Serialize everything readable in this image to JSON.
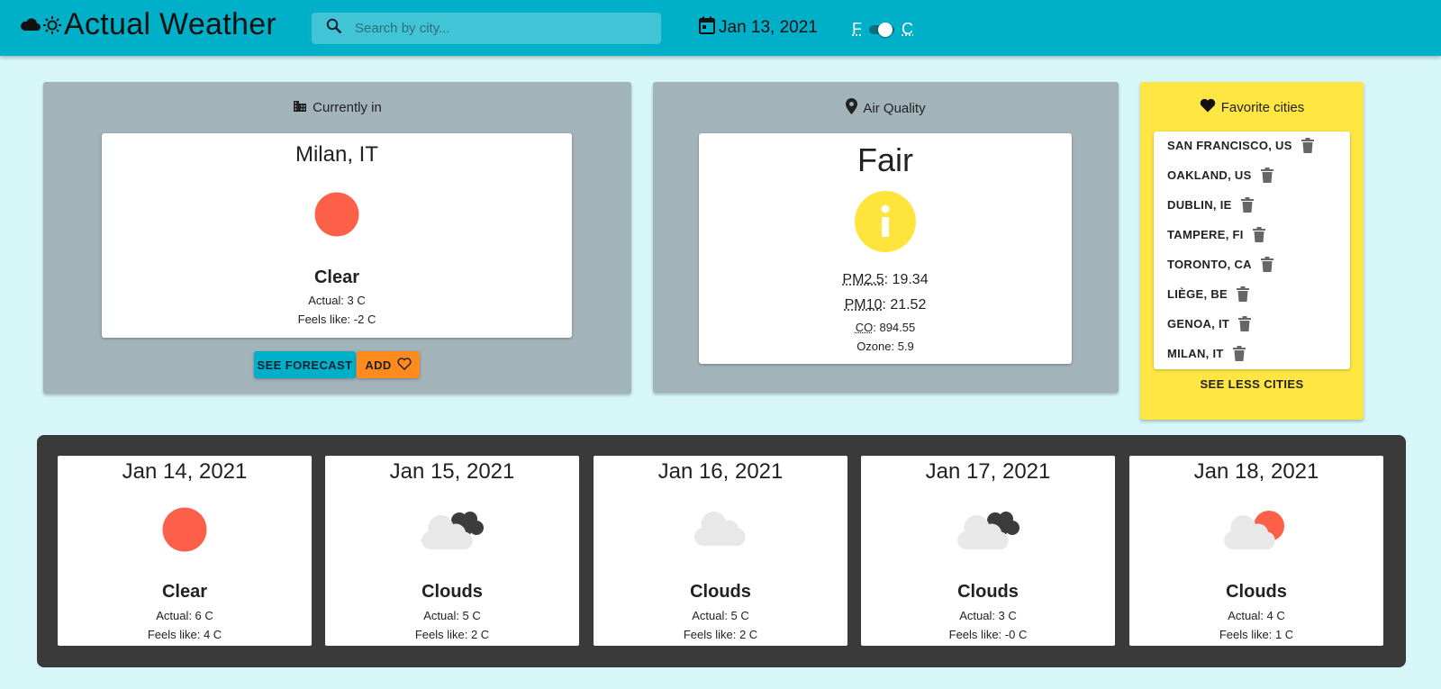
{
  "header": {
    "title": "Actual Weather",
    "search_placeholder": "Search by city...",
    "date": "Jan 13, 2021",
    "unit_left": "F",
    "unit_right": "C",
    "colors": {
      "bar": "#00b0c8"
    }
  },
  "current": {
    "heading": "Currently in",
    "city": "Milan, IT",
    "condition": "Clear",
    "actual": "Actual: 3 C",
    "feels": "Feels like: -2 C",
    "icon": "sun-icon",
    "forecast_button": "SEE FORECAST",
    "add_button": "ADD"
  },
  "air": {
    "heading": "Air Quality",
    "rating": "Fair",
    "icon": "info-icon",
    "pm25_label": "PM2.5",
    "pm25_value": ": 19.34",
    "pm10_label": "PM10",
    "pm10_value": ": 21.52",
    "co_label": "CO",
    "co_value": ": 894.55",
    "ozone": "Ozone: 5.9"
  },
  "favorites": {
    "heading": "Favorite cities",
    "cities": [
      "SAN FRANCISCO, US",
      "OAKLAND, US",
      "DUBLIN, IE",
      "TAMPERE, FI",
      "TORONTO, CA",
      "LIÈGE, BE",
      "GENOA, IT",
      "MILAN, IT"
    ],
    "see_less": "SEE LESS CITIES"
  },
  "forecast": [
    {
      "date": "Jan 14, 2021",
      "condition": "Clear",
      "actual": "Actual: 6 C",
      "feels": "Feels like: 4 C",
      "icon": "sun-icon"
    },
    {
      "date": "Jan 15, 2021",
      "condition": "Clouds",
      "actual": "Actual: 5 C",
      "feels": "Feels like: 2 C",
      "icon": "broken-clouds-icon"
    },
    {
      "date": "Jan 16, 2021",
      "condition": "Clouds",
      "actual": "Actual: 5 C",
      "feels": "Feels like: 2 C",
      "icon": "cloud-icon"
    },
    {
      "date": "Jan 17, 2021",
      "condition": "Clouds",
      "actual": "Actual: 3 C",
      "feels": "Feels like: -0 C",
      "icon": "broken-clouds-icon"
    },
    {
      "date": "Jan 18, 2021",
      "condition": "Clouds",
      "actual": "Actual: 4 C",
      "feels": "Feels like: 1 C",
      "icon": "few-clouds-icon"
    }
  ]
}
